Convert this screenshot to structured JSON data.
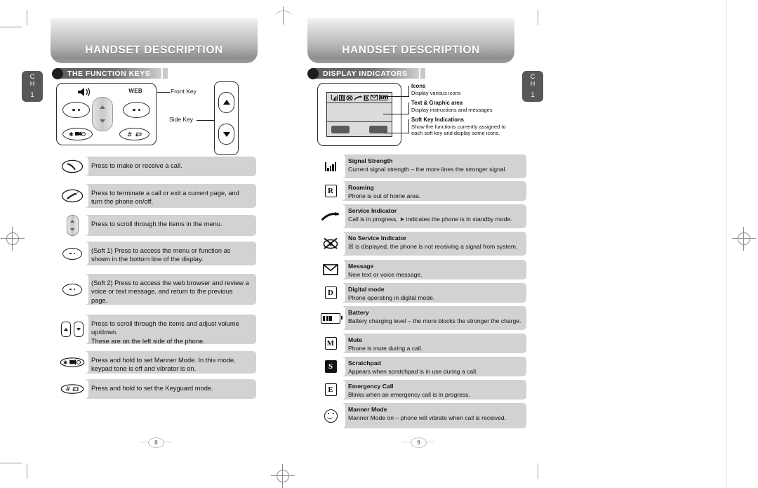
{
  "document": {
    "banner_title": "HANDSET DESCRIPTION",
    "index_tab": {
      "ch": "C\nH",
      "number": "1"
    }
  },
  "left_page": {
    "page_number": "8",
    "banner_title": "HANDSET DESCRIPTION",
    "section_title": "THE FUNCTION KEYS",
    "diagram": {
      "speaker_icon": "speaker-icon",
      "web_label": "WEB",
      "front_key_label": "Front Key",
      "side_key_label": "Side Key",
      "star_key": "✶⌘☼",
      "pound_key": "⌗ ⏎"
    },
    "function_keys": [
      {
        "icon": "send-key-icon",
        "text": "Press to make or receive a call."
      },
      {
        "icon": "end-key-icon",
        "text": "Press to terminate a call or exit a current page, and turn the phone on/off."
      },
      {
        "icon": "navigation-key-icon",
        "text": "Press to scroll through the items in the menu."
      },
      {
        "icon": "soft-key-1-icon",
        "text": "(Soft 1) Press to access the menu or function as shown in the bottom line of the display."
      },
      {
        "icon": "soft-key-2-icon",
        "text": "(Soft 2) Press to access the web browser and review a voice or text message, and return to the previous page."
      },
      {
        "icon": "side-volume-keys-icon",
        "text": "Press to scroll through the items and adjust volume up/down.\nThese are on the left side of the phone."
      },
      {
        "icon": "star-manner-key-icon",
        "text": "Press and hold to set Manner Mode. In this mode, keypad tone is off and vibrator is on."
      },
      {
        "icon": "pound-keyguard-key-icon",
        "text": "Press and hold to set the Keyguard mode."
      }
    ]
  },
  "right_page": {
    "page_number": "9",
    "banner_title": "HANDSET DESCRIPTION",
    "section_title": "DISPLAY INDICATORS",
    "lcd_callouts": [
      {
        "heading": "Icons",
        "detail": "Display various icons"
      },
      {
        "heading": "Text & Graphic area",
        "detail": "Display instructions and messages"
      },
      {
        "heading": "Soft Key Indications",
        "detail": "Show the functions currently assigned to each soft key and display some icons."
      }
    ],
    "indicators": [
      {
        "icon": "signal-strength-icon",
        "heading": "Signal Strength",
        "detail": "Current signal strength – the more lines the stronger signal."
      },
      {
        "icon": "roaming-icon",
        "heading": "Roaming",
        "detail": "Phone is out of home area."
      },
      {
        "icon": "service-indicator-icon",
        "heading": "Service Indicator",
        "detail": "Call is in progress, ➤ indicates the phone is in standby mode."
      },
      {
        "icon": "no-service-indicator-icon",
        "heading": "No Service Indicator",
        "detail": "☒ is displayed, the phone is not receiving a signal from system."
      },
      {
        "icon": "message-icon",
        "heading": "Message",
        "detail": "New text or voice message."
      },
      {
        "icon": "digital-mode-icon",
        "heading": "Digital mode",
        "detail": "Phone operating in digital mode."
      },
      {
        "icon": "battery-icon",
        "heading": "Battery",
        "detail": "Battery charging level – the more blocks the stronger the charge."
      },
      {
        "icon": "mute-icon",
        "heading": "Mute",
        "detail": "Phone is mute during a call."
      },
      {
        "icon": "scratchpad-icon",
        "heading": "Scratchpad",
        "detail": "Appears when scratchpad is in use during a call."
      },
      {
        "icon": "emergency-call-icon",
        "heading": "Emergency Call",
        "detail": "Blinks when an emergency call is in progress."
      },
      {
        "icon": "manner-mode-icon",
        "heading": "Manner Mode",
        "detail": "Manner Mode on – phone will vibrate when call is received."
      }
    ],
    "indicator_letters": {
      "roaming": "R",
      "digital": "D",
      "mute": "M",
      "scratchpad": "S",
      "emergency": "E"
    }
  },
  "colors": {
    "row_bg": "#d2d2d2",
    "icon_bg": "#ffffff",
    "banner_dark": "#8f8f8f",
    "tab_bg": "#58585a",
    "text": "#111111"
  }
}
